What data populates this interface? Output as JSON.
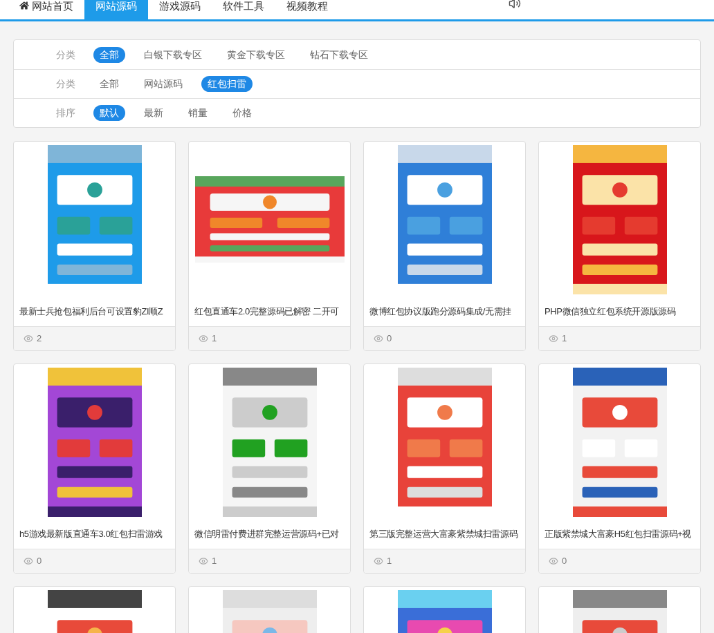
{
  "nav": {
    "items": [
      {
        "label": "网站首页",
        "selected": false
      },
      {
        "label": "网站源码",
        "selected": true
      },
      {
        "label": "游戏源码",
        "selected": false
      },
      {
        "label": "软件工具",
        "selected": false
      },
      {
        "label": "视频教程",
        "selected": false
      }
    ]
  },
  "filters": [
    {
      "label": "分类",
      "options": [
        {
          "label": "全部",
          "selected": true
        },
        {
          "label": "白银下载专区",
          "selected": false
        },
        {
          "label": "黄金下载专区",
          "selected": false
        },
        {
          "label": "钻石下载专区",
          "selected": false
        }
      ]
    },
    {
      "label": "分类",
      "options": [
        {
          "label": "全部",
          "selected": false
        },
        {
          "label": "网站源码",
          "selected": false
        },
        {
          "label": "红包扫雷",
          "selected": true
        }
      ]
    },
    {
      "label": "排序",
      "options": [
        {
          "label": "默认",
          "selected": true
        },
        {
          "label": "最新",
          "selected": false
        },
        {
          "label": "销量",
          "selected": false
        },
        {
          "label": "价格",
          "selected": false
        }
      ]
    }
  ],
  "cards": [
    {
      "image": {
        "kind": "picture"
      },
      "title": "最新士兵抢包福利后台可设置豹ZI顺Z",
      "views": "2"
    },
    {
      "image": {
        "kind": "picture"
      },
      "title": "红包直通车2.0完整源码已解密 二开可",
      "views": "1"
    },
    {
      "image": {
        "kind": "picture"
      },
      "title": "微博红包协议版跑分源码集成/无需挂",
      "views": "0"
    },
    {
      "image": {
        "kind": "picture"
      },
      "title": "PHP微信独立红包系统开源版源码",
      "views": "1"
    },
    {
      "image": {
        "kind": "picture"
      },
      "title": "h5游戏最新版直通车3.0红包扫雷游戏",
      "views": "0"
    },
    {
      "image": {
        "kind": "picture"
      },
      "title": "微信明雷付费进群完整运营源码+已对",
      "views": "1"
    },
    {
      "image": {
        "kind": "picture"
      },
      "title": "第三版完整运营大富豪紫禁城扫雷源码",
      "views": "1"
    },
    {
      "image": {
        "kind": "picture"
      },
      "title": "正版紫禁城大富豪H5红包扫雷源码+视",
      "views": "0"
    },
    {
      "image": {
        "kind": "picture"
      }
    },
    {
      "image": {
        "kind": "picture"
      }
    },
    {
      "image": {
        "kind": "picture"
      }
    },
    {
      "image": {
        "kind": "picture"
      }
    }
  ]
}
